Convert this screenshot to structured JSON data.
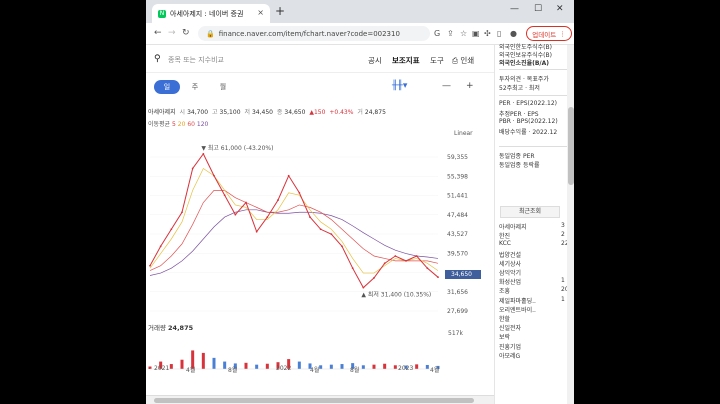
{
  "browser": {
    "tab_title": "아세아제지 : 네이버 증권",
    "tab_close": "×",
    "new_tab": "+",
    "url": "finance.naver.com/item/fchart.naver?code=002310",
    "update_label": "업데이트",
    "controls": {
      "minimize": "—",
      "maximize": "☐",
      "close": "✕"
    }
  },
  "toolbar": {
    "search_placeholder": "종목 또는 지수비교",
    "menu": [
      "공시",
      "보조지표",
      "도구"
    ],
    "print": "인쇄"
  },
  "periods": [
    "일",
    "주",
    "월"
  ],
  "info": {
    "name": "아세아제지",
    "open_label": "시",
    "open": "34,700",
    "high_label": "고",
    "high": "35,100",
    "low_label": "저",
    "low": "34,450",
    "close_label": "종",
    "close": "34,650",
    "change": "▲150",
    "change_pct": "+0.43%",
    "volume_label": "거",
    "volume": "24,875"
  },
  "moving_average": {
    "label": "이동평균",
    "values": [
      "5",
      "20",
      "60",
      "120"
    ]
  },
  "scale": "Linear",
  "price_tag": "34,650",
  "annotations": {
    "high": "▼ 최고 61,000 (-43.20%)",
    "low": "▲ 최저 31,400 (10.35%)"
  },
  "volume_caption": {
    "label": "거래량",
    "value": "24,875"
  },
  "volume_axis": "517k",
  "chart_data": {
    "type": "line",
    "title": "아세아제지",
    "x": [
      "2021-01",
      "2021-02",
      "2021-03",
      "2021-04",
      "2021-05",
      "2021-06",
      "2021-07",
      "2021-08",
      "2021-09",
      "2021-10",
      "2021-11",
      "2021-12",
      "2022-01",
      "2022-02",
      "2022-03",
      "2022-04",
      "2022-05",
      "2022-06",
      "2022-07",
      "2022-08",
      "2022-09",
      "2022-10",
      "2022-11",
      "2022-12",
      "2023-01",
      "2023-02",
      "2023-03",
      "2023-04"
    ],
    "x_tick_labels": [
      "2021",
      "4월",
      "8월",
      "2022",
      "4월",
      "8월",
      "2023",
      "4월"
    ],
    "y_tick_labels": [
      "59,355",
      "55,398",
      "51,441",
      "47,484",
      "43,527",
      "39,570",
      "35,613",
      "31,656",
      "27,699"
    ],
    "ylim": [
      27699,
      61000
    ],
    "series": [
      {
        "values": [
          37000,
          41000,
          44500,
          48000,
          57000,
          60000,
          55500,
          51500,
          47500,
          50000,
          44000,
          47000,
          50500,
          55500,
          52000,
          47000,
          44500,
          43500,
          41000,
          36500,
          32500,
          34500,
          37500,
          39000,
          38000,
          39000,
          36500,
          34650
        ],
        "color": "#d8323a"
      },
      {
        "values": [
          36500,
          39500,
          42500,
          46000,
          52500,
          57000,
          55500,
          52500,
          49500,
          49000,
          46500,
          46500,
          48500,
          52000,
          51500,
          48500,
          46000,
          44500,
          42000,
          38500,
          35500,
          35500,
          37000,
          38500,
          38000,
          38500,
          37500,
          36000
        ],
        "color": "#e8c040"
      },
      {
        "values": [
          36000,
          37000,
          39000,
          41500,
          45500,
          50000,
          52500,
          52500,
          51000,
          50000,
          49000,
          48000,
          48000,
          48500,
          49500,
          49000,
          48000,
          46500,
          44500,
          42500,
          40500,
          39000,
          38500,
          38000,
          38000,
          38000,
          38000,
          37500
        ],
        "color": "#e05050"
      },
      {
        "values": [
          35000,
          35500,
          36500,
          38000,
          40000,
          42500,
          45000,
          47000,
          48000,
          48500,
          48500,
          48000,
          47800,
          47800,
          48000,
          48000,
          47800,
          47300,
          46500,
          45200,
          43800,
          42500,
          41200,
          40200,
          39500,
          39000,
          38800,
          38500
        ],
        "color": "#7a50a0"
      }
    ],
    "volume": [
      40,
      120,
      80,
      150,
      300,
      260,
      180,
      120,
      90,
      100,
      70,
      85,
      110,
      160,
      120,
      90,
      60,
      70,
      80,
      95,
      60,
      70,
      85,
      60,
      55,
      75,
      65,
      50
    ],
    "volume_ylim": [
      0,
      517000
    ]
  },
  "sidebar": {
    "top_items": [
      "외국인한도주식수(B)",
      "외국인보유주식수(B)",
      "외국인소진율(B/A)",
      "투자의견 · 목표주가",
      "52주최고 · 최저",
      "PER · EPS(2022.12)",
      "추정PER · EPS",
      "PBR · BPS(2022.12)",
      "배당수익률 · 2022.12",
      "동일업종 PER",
      "동일업종 등락률"
    ],
    "recent_label": "최근조회",
    "recent_items": [
      {
        "name": "아세아제지",
        "val": "3"
      },
      {
        "name": "한진",
        "val": "2"
      },
      {
        "name": "KCC",
        "val": "22"
      },
      {
        "name": "법양건설",
        "val": ""
      },
      {
        "name": "세기상사",
        "val": ""
      },
      {
        "name": "삼익악기",
        "val": ""
      },
      {
        "name": "화성산업",
        "val": "1"
      },
      {
        "name": "조흥",
        "val": "20"
      },
      {
        "name": "제일파마홀딩..",
        "val": "1"
      },
      {
        "name": "오리엔트바이..",
        "val": ""
      },
      {
        "name": "한할",
        "val": ""
      },
      {
        "name": "신일전자",
        "val": ""
      },
      {
        "name": "보락",
        "val": ""
      },
      {
        "name": "진흥기업",
        "val": ""
      },
      {
        "name": "아모레G",
        "val": ""
      }
    ]
  }
}
